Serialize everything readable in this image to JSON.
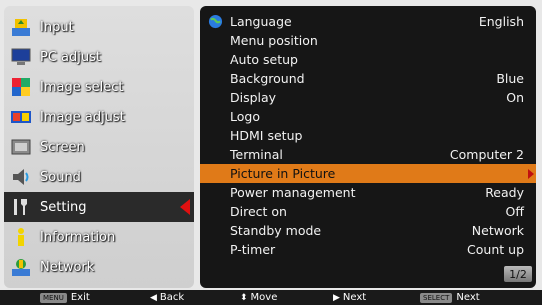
{
  "sidebar": {
    "items": [
      {
        "label": "Input",
        "icon": "input-icon"
      },
      {
        "label": "PC adjust",
        "icon": "pc-adjust-icon"
      },
      {
        "label": "Image select",
        "icon": "image-select-icon"
      },
      {
        "label": "Image adjust",
        "icon": "image-adjust-icon"
      },
      {
        "label": "Screen",
        "icon": "screen-icon"
      },
      {
        "label": "Sound",
        "icon": "sound-icon"
      },
      {
        "label": "Setting",
        "icon": "setting-icon"
      },
      {
        "label": "Information",
        "icon": "information-icon"
      },
      {
        "label": "Network",
        "icon": "network-icon"
      }
    ],
    "active_index": 6
  },
  "menu": {
    "rows": [
      {
        "name": "Language",
        "value": "English"
      },
      {
        "name": "Menu position",
        "value": ""
      },
      {
        "name": "Auto setup",
        "value": ""
      },
      {
        "name": "Background",
        "value": "Blue"
      },
      {
        "name": "Display",
        "value": "On"
      },
      {
        "name": "Logo",
        "value": ""
      },
      {
        "name": "HDMI setup",
        "value": ""
      },
      {
        "name": "Terminal",
        "value": "Computer 2"
      },
      {
        "name": "Picture in Picture",
        "value": ""
      },
      {
        "name": "Power management",
        "value": "Ready"
      },
      {
        "name": "Direct on",
        "value": "Off"
      },
      {
        "name": "Standby mode",
        "value": "Network"
      },
      {
        "name": "P-timer",
        "value": "Count up"
      }
    ],
    "selected_index": 8,
    "page_indicator": "1/2"
  },
  "footer": {
    "exit": {
      "key": "MENU",
      "label": "Exit"
    },
    "back": {
      "glyph": "◀",
      "label": "Back"
    },
    "move": {
      "glyph": "⬍",
      "label": "Move"
    },
    "next": {
      "glyph": "▶",
      "label": "Next"
    },
    "select_next": {
      "key": "SELECT",
      "label": "Next"
    }
  },
  "colors": {
    "highlight": "#e07a18",
    "active_arrow": "#e01010",
    "panel_bg": "#161616"
  }
}
